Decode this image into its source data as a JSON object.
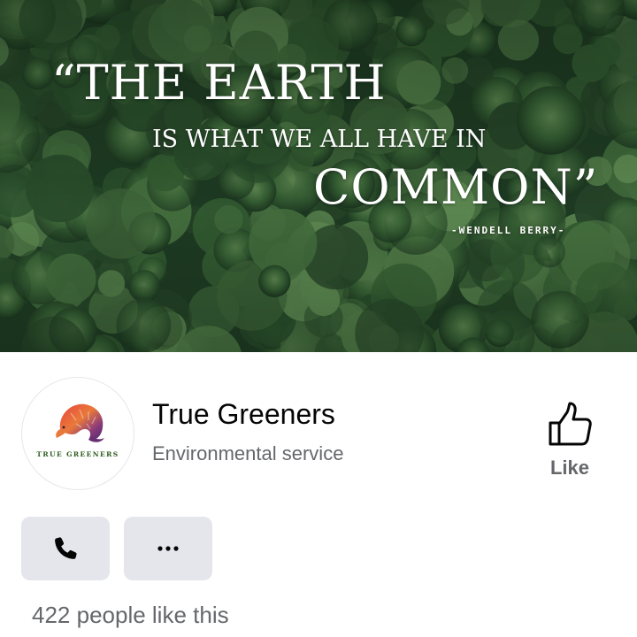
{
  "cover": {
    "quote_line1": "“THE EARTH",
    "quote_line2": "IS WHAT WE ALL HAVE IN",
    "quote_line3": "COMMON”",
    "quote_author": "-WENDELL BERRY-"
  },
  "profile": {
    "avatar_text": "TRUE GREENERS",
    "name": "True Greeners",
    "category": "Environmental service"
  },
  "actions": {
    "like_label": "Like",
    "call_icon": "phone-icon",
    "more_icon": "more-dots-icon"
  },
  "stats": {
    "likes_text": "422 people like this"
  },
  "colors": {
    "text_primary": "#050505",
    "text_secondary": "#65676b",
    "button_bg": "#e4e6eb",
    "forest_dark": "#1f3a24"
  }
}
